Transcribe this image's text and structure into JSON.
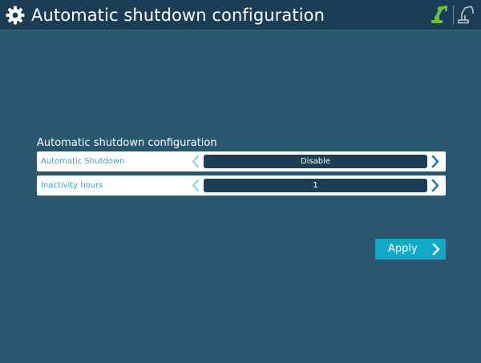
{
  "header": {
    "title": "Automatic shutdown configuration",
    "icons": [
      "gear-icon",
      "robot-arm-icon",
      "robot-arm-icon"
    ],
    "colors": {
      "bar": "#1b3d56",
      "active_icon": "#6dc13a",
      "inactive_icon": "#c8c8c8"
    }
  },
  "section": {
    "title": "Automatic shutdown configuration",
    "rows": [
      {
        "label": "Automatic Shutdown",
        "value": "Disable"
      },
      {
        "label": "Inactivity hours",
        "value": "1"
      }
    ]
  },
  "actions": {
    "apply_label": "Apply",
    "color": "#14a8c7"
  }
}
